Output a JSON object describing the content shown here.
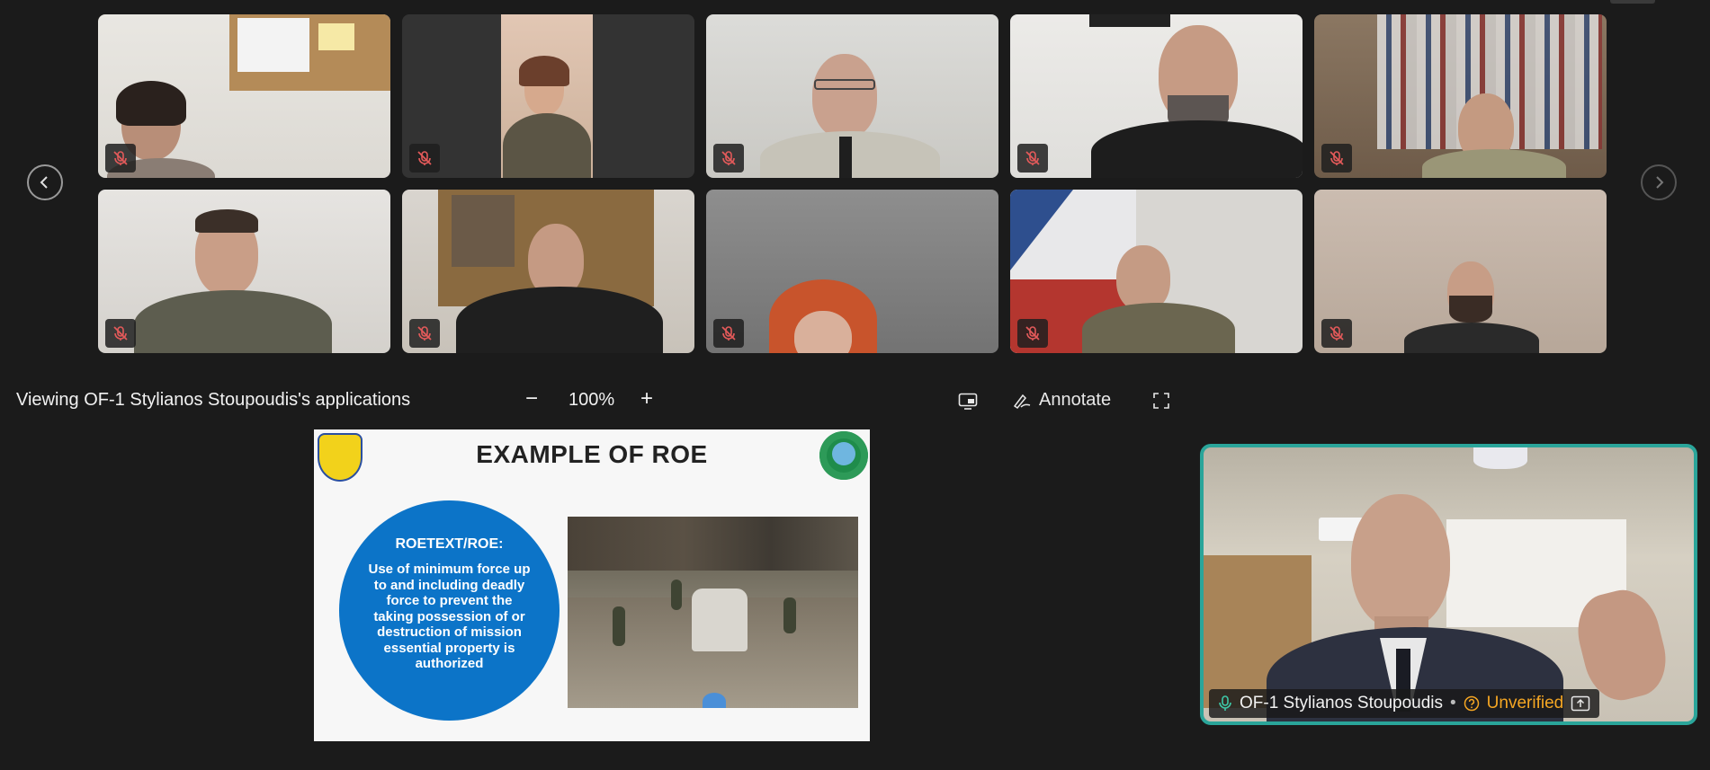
{
  "colors": {
    "background": "#1b1b1b",
    "speaker_border": "#2aa59a",
    "roe_circle": "#0c74c8",
    "unverified": "#f5a623",
    "mute_icon": "#e35a5a"
  },
  "gallery": {
    "prev_icon": "chevron-left-icon",
    "next_icon": "chevron-right-icon",
    "tiles": [
      {
        "id": "p1",
        "muted": true
      },
      {
        "id": "p2",
        "muted": true
      },
      {
        "id": "p3",
        "muted": true
      },
      {
        "id": "p4",
        "muted": true
      },
      {
        "id": "p5",
        "muted": true
      },
      {
        "id": "p6",
        "muted": true
      },
      {
        "id": "p7",
        "muted": true
      },
      {
        "id": "p8",
        "muted": true
      },
      {
        "id": "p9",
        "muted": true
      },
      {
        "id": "p10",
        "muted": true
      }
    ]
  },
  "share_bar": {
    "title": "Viewing OF-1 Stylianos Stoupoudis's applications",
    "zoom_out": "−",
    "zoom_level": "100%",
    "zoom_in": "+",
    "annotate_label": "Annotate"
  },
  "slide": {
    "title": "EXAMPLE OF ROE",
    "circle_heading": "ROETEXT/ROE:",
    "circle_text": "Use of minimum force up to and including deadly force to prevent the taking possession of or destruction of mission essential property is authorized"
  },
  "speaker": {
    "name": "OF-1 Stylianos Stoupoudis",
    "separator": "•",
    "status": "Unverified"
  }
}
